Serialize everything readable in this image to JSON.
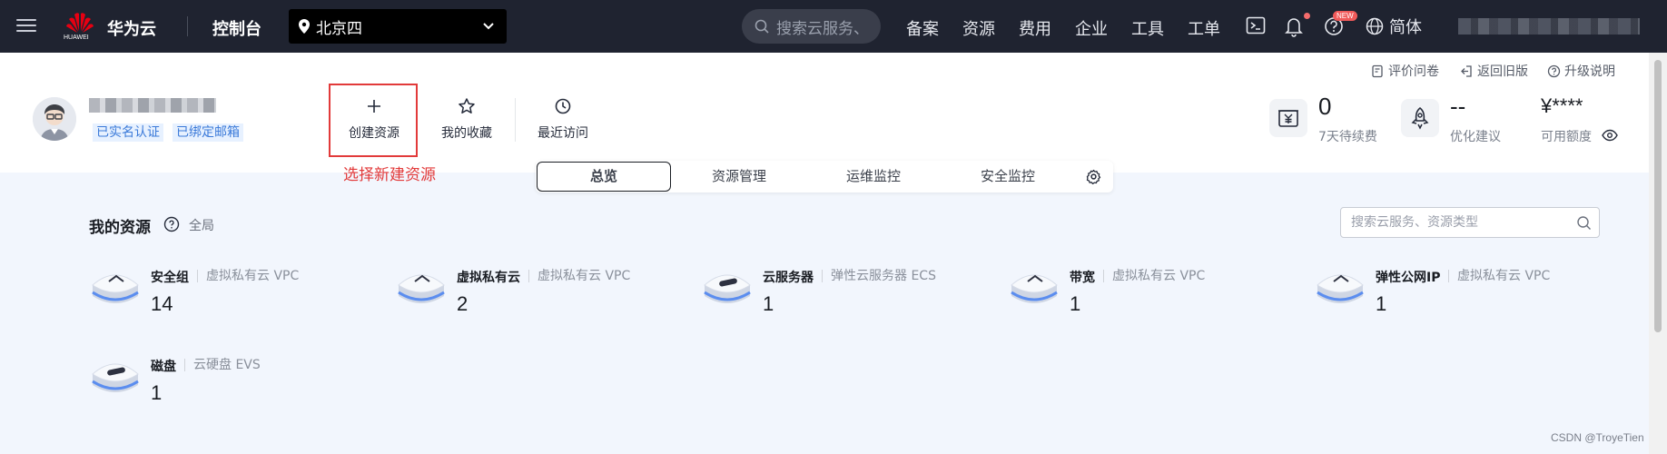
{
  "nav": {
    "logo_text": "HUAWEI",
    "brand": "华为云",
    "console": "控制台",
    "region": "北京四",
    "search_placeholder": "搜索云服务、",
    "links": [
      "备案",
      "资源",
      "费用",
      "企业",
      "工具",
      "工单"
    ],
    "badge_new": "NEW",
    "language": "简体"
  },
  "top_links": [
    "评价问卷",
    "返回旧版",
    "升级说明"
  ],
  "user": {
    "tags": [
      "已实名认证",
      "已绑定邮箱"
    ]
  },
  "quick_actions": [
    "创建资源",
    "我的收藏",
    "最近访问"
  ],
  "annotation": "选择新建资源",
  "stats": [
    {
      "value": "0",
      "label": "7天待续费",
      "icon": "renewal-yen-icon"
    },
    {
      "value": "--",
      "label": "优化建议",
      "icon": "rocket-icon"
    },
    {
      "value": "¥****",
      "label": "可用额度",
      "icon": "eye-icon"
    }
  ],
  "tabs": [
    {
      "label": "总览",
      "active": true
    },
    {
      "label": "资源管理",
      "active": false
    },
    {
      "label": "运维监控",
      "active": false
    },
    {
      "label": "安全监控",
      "active": false
    }
  ],
  "resources": {
    "title": "我的资源",
    "scope": "全局",
    "search_placeholder": "搜索云服务、资源类型",
    "items": [
      {
        "name": "安全组",
        "category": "虚拟私有云 VPC",
        "count": "14"
      },
      {
        "name": "虚拟私有云",
        "category": "虚拟私有云 VPC",
        "count": "2"
      },
      {
        "name": "云服务器",
        "category": "弹性云服务器 ECS",
        "count": "1"
      },
      {
        "name": "带宽",
        "category": "虚拟私有云 VPC",
        "count": "1"
      },
      {
        "name": "弹性公网IP",
        "category": "虚拟私有云 VPC",
        "count": "1"
      },
      {
        "name": "磁盘",
        "category": "云硬盘 EVS",
        "count": "1"
      }
    ]
  },
  "watermark": "CSDN @TroyeTien",
  "colors": {
    "nav_bg": "#1f2330",
    "accent_red": "#e23a3a",
    "tag_blue": "#3b7ad9",
    "page_bg": "#f2f6fd"
  }
}
